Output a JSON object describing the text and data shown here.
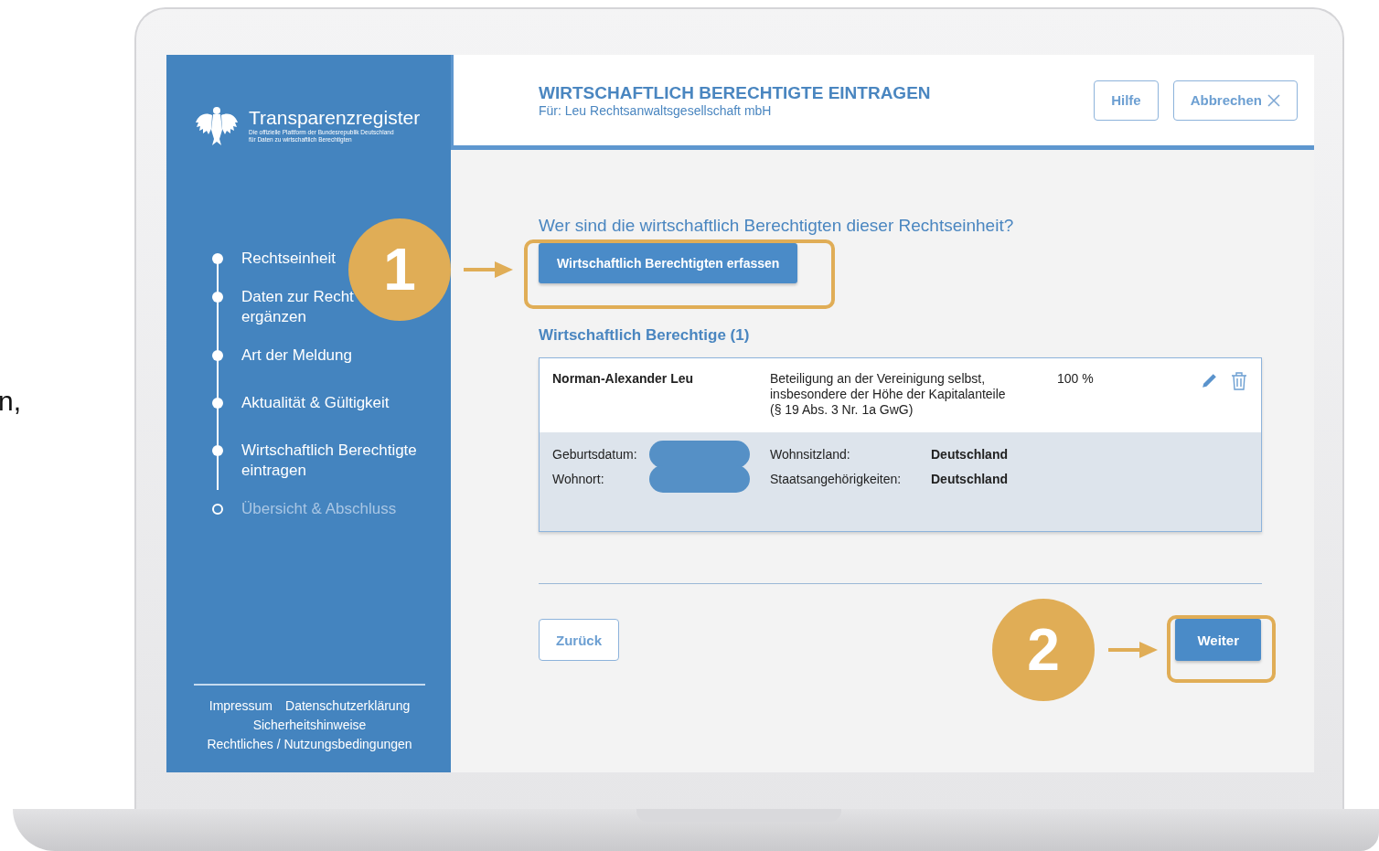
{
  "side_text": "n,",
  "brand": {
    "title": "Transparenzregister",
    "subtitle_lines": [
      "Die offizielle Plattform der Bundesrepublik Deutschland",
      "für Daten zu wirtschaftlich Berechtigten"
    ]
  },
  "steps": [
    {
      "lines": [
        "Rechtseinheit"
      ],
      "done": true
    },
    {
      "lines": [
        "Daten zur Recht",
        "ergänzen"
      ],
      "done": true
    },
    {
      "lines": [
        "Art der Meldung"
      ],
      "done": true
    },
    {
      "lines": [
        "Aktualität & Gültigkeit"
      ],
      "done": true
    },
    {
      "lines": [
        "Wirtschaftlich Berechtigte",
        "eintragen"
      ],
      "done": true
    },
    {
      "lines": [
        "Übersicht & Abschluss"
      ],
      "done": false
    }
  ],
  "footer_links": [
    [
      "Impressum",
      "Datenschutzerklärung"
    ],
    [
      "Sicherheitshinweise"
    ],
    [
      "Rechtliches / Nutzungsbedingungen"
    ]
  ],
  "header": {
    "title": "WIRTSCHAFTLICH BERECHTIGTE EINTRAGEN",
    "subtitle": "Für: Leu Rechtsanwaltsgesellschaft mbH",
    "buttons": [
      {
        "label": "Hilfe",
        "kind": "help"
      },
      {
        "label": "Abbrechen",
        "kind": "cancel"
      }
    ]
  },
  "question": "Wer sind die wirtschaftlich Berechtigten dieser Rechtseinheit?",
  "primary_button": "Wirtschaftlich Berechtigten erfassen",
  "list_heading": "Wirtschaftlich Berechtige (1)",
  "entries": [
    {
      "name": "Norman-Alexander Leu",
      "role_lines": [
        "Beteiligung an der Vereinigung selbst,",
        "insbesondere der Höhe der Kapitalanteile",
        "(§ 19 Abs. 3 Nr. 1a GwG)"
      ],
      "share": "100 %",
      "details_left": [
        {
          "label": "Geburtsdatum:",
          "redacted": true
        },
        {
          "label": "Wohnort:",
          "redacted": true
        }
      ],
      "details_right": [
        {
          "label": "Wohnsitzland:",
          "value": "Deutschland"
        },
        {
          "label": "Staatsangehörigkeiten:",
          "value": "Deutschland"
        }
      ]
    }
  ],
  "nav": {
    "back": "Zurück",
    "next": "Weiter"
  },
  "annotations": [
    {
      "number": "1"
    },
    {
      "number": "2"
    }
  ]
}
